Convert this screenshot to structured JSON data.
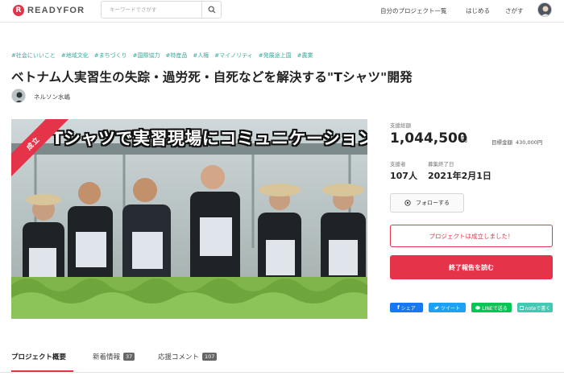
{
  "header": {
    "logo_mark": "R",
    "logo_text": "READYFOR",
    "search_placeholder": "キーワードでさがす",
    "nav": [
      "自分のプロジェクト一覧",
      "はじめる",
      "さがす"
    ]
  },
  "tags": [
    "#社会にいいこと",
    "#地域文化",
    "#まちづくり",
    "#国際協力",
    "#特産品",
    "#人権",
    "#マイノリティ",
    "#発展途上国",
    "#農業"
  ],
  "title": "ベトナム人実習生の失踪・過労死・自死などを解決する\"Tシャツ\"開発",
  "author": "ネルソン水嶋",
  "hero": {
    "headline": "Tシャツで実習現場にコミュニケーションを",
    "ribbon": "成立"
  },
  "stats": {
    "total_label": "支援総額",
    "total_value": "1,044,500",
    "total_unit": "円",
    "goal_label": "目標金額",
    "goal_value": "430,000円",
    "supporters_label": "支援者",
    "supporters_value": "107人",
    "end_label": "募集終了日",
    "end_value": "2021年2月1日"
  },
  "actions": {
    "follow": "フォローする",
    "success": "プロジェクトは成立しました！",
    "report": "終了報告を読む"
  },
  "share": {
    "facebook": "シェア",
    "twitter": "ツイート",
    "line": "LINEで送る",
    "note": "noteで書く"
  },
  "tabs": [
    {
      "label": "プロジェクト概要",
      "count": ""
    },
    {
      "label": "新着情報",
      "count": "37"
    },
    {
      "label": "応援コメント",
      "count": "107"
    }
  ],
  "colors": {
    "accent": "#e5344a",
    "tag": "#39a89a",
    "facebook": "#1877f2",
    "twitter": "#1da1f2",
    "line": "#06c755",
    "note": "#41c9b4"
  }
}
